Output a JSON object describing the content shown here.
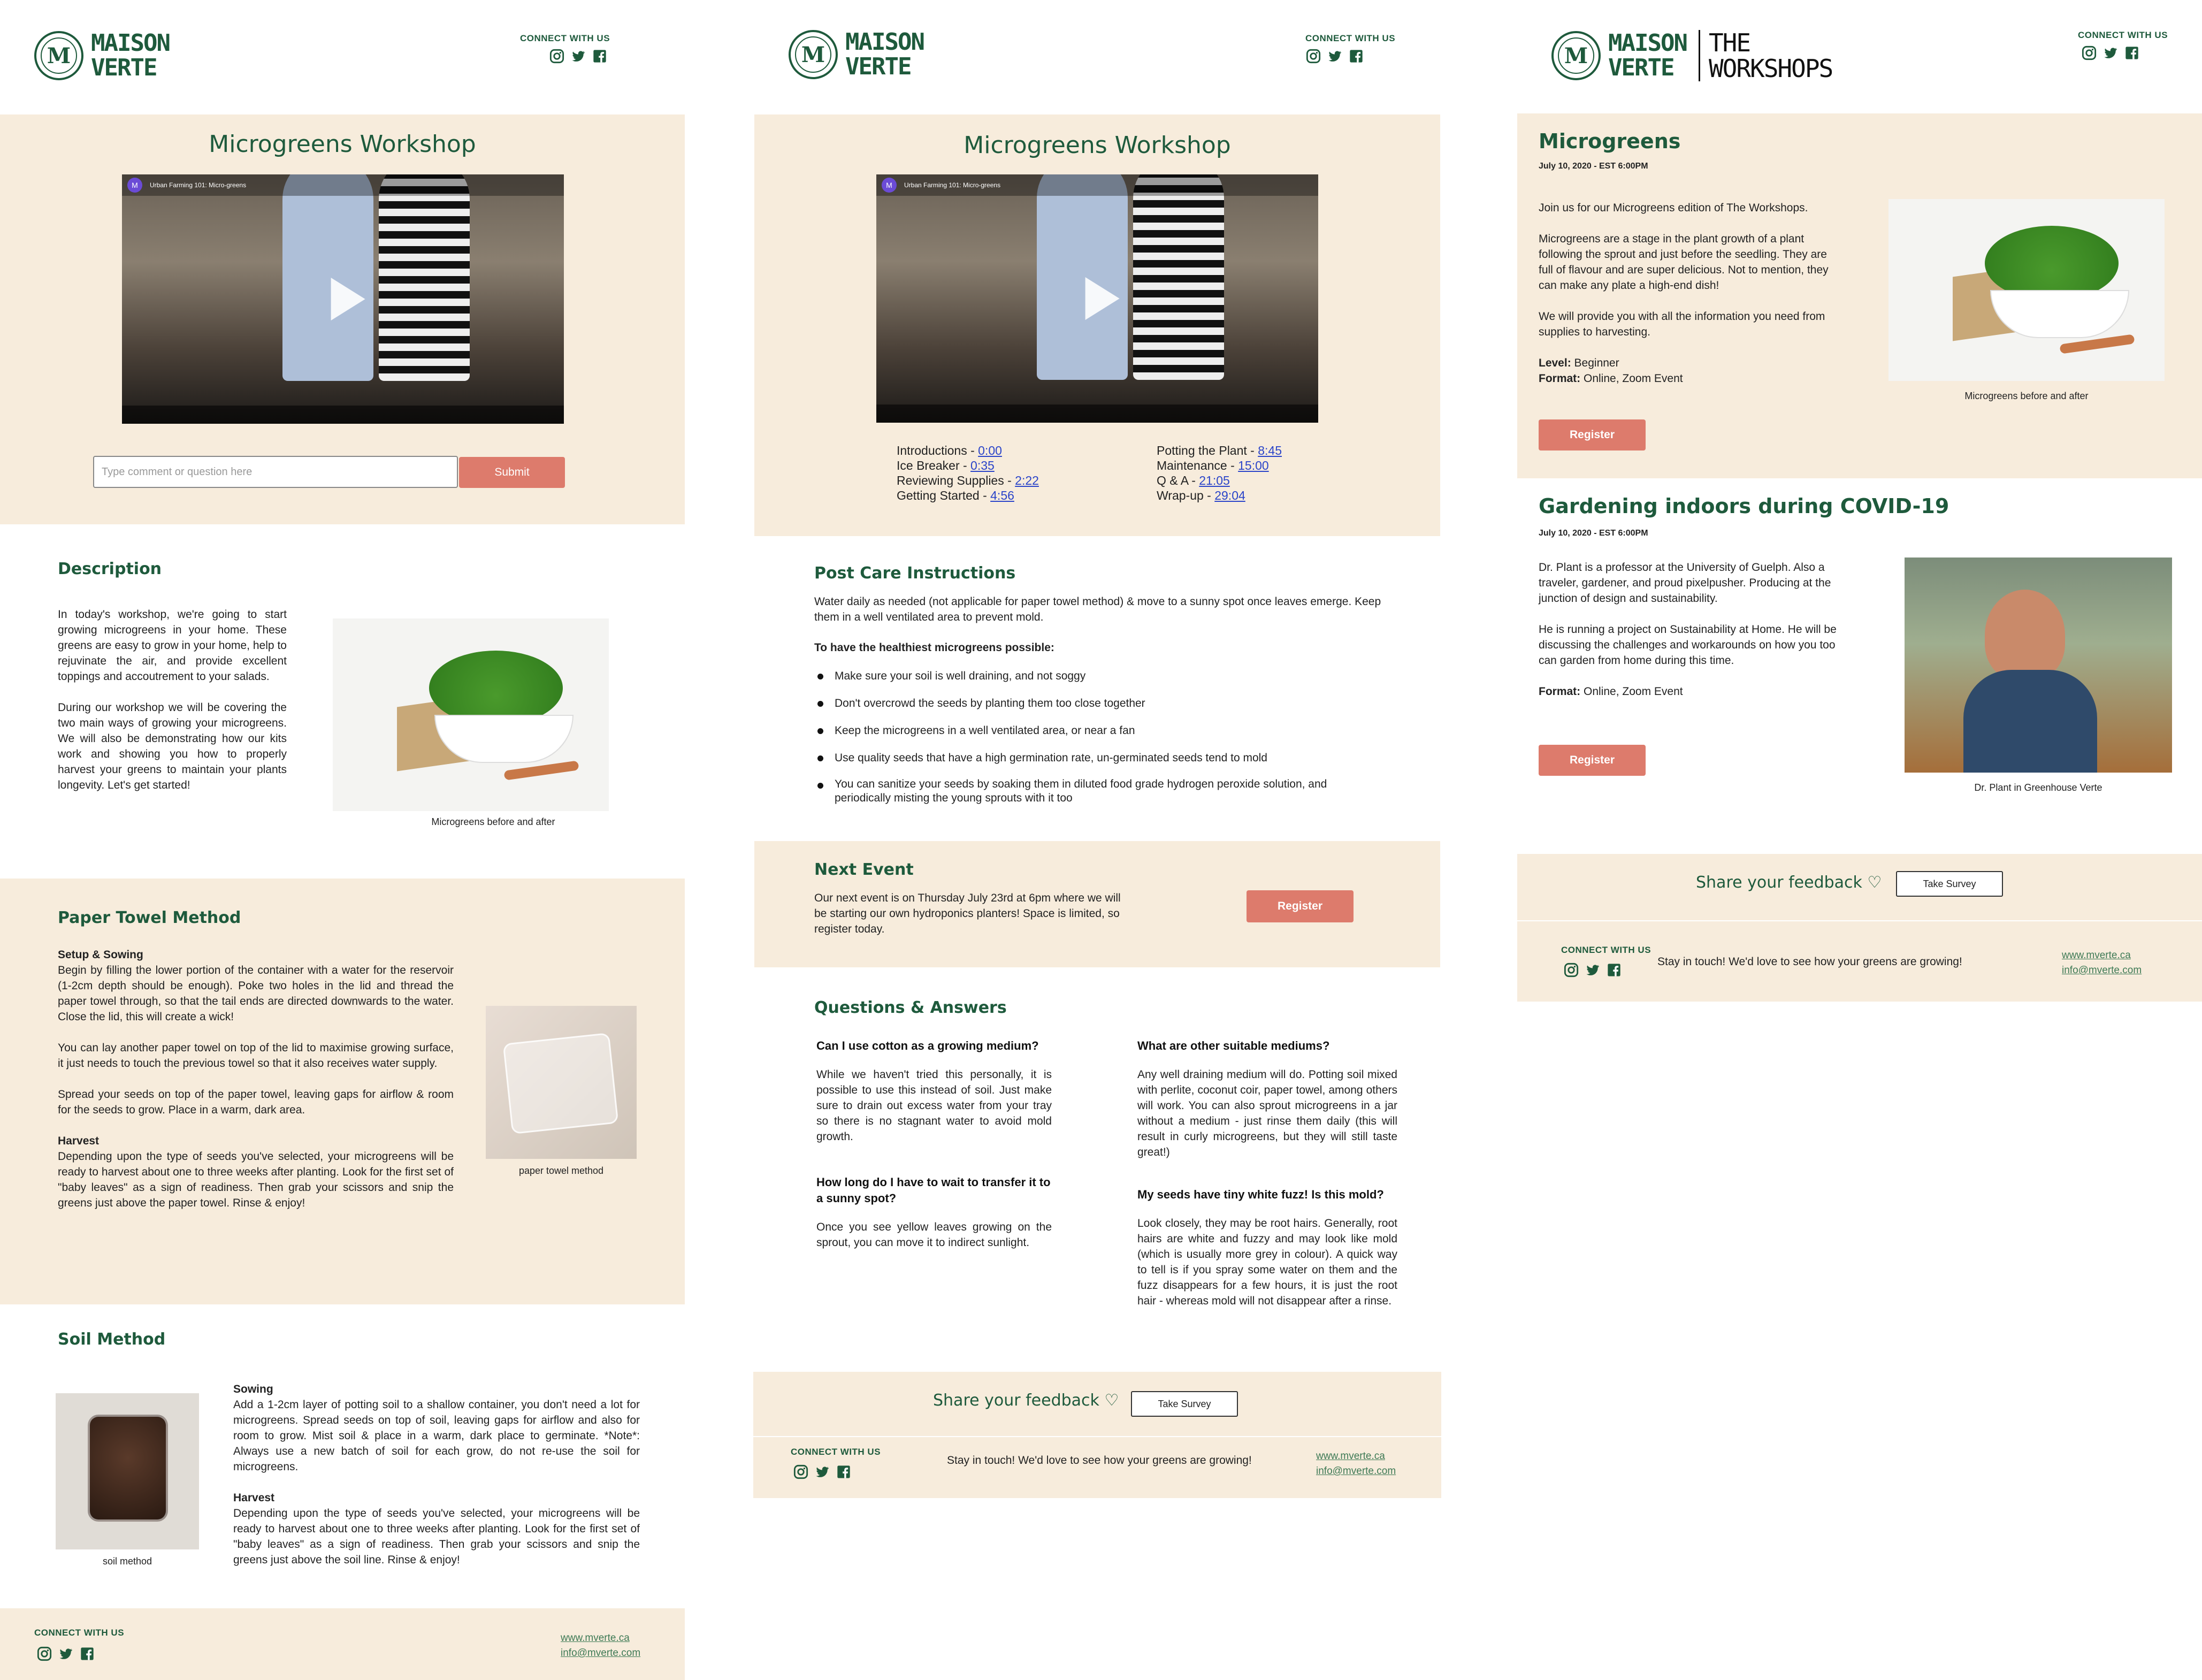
{
  "brand": {
    "logo_initial": "M",
    "logo_line1": "MAISON",
    "logo_line2": "VERTE",
    "workshops_line1": "THE",
    "workshops_line2": "WORKSHOPS",
    "connect_label": "CONNECT WITH US",
    "colors": {
      "green": "#1e5a3c",
      "beige": "#f7ecdc",
      "accent_red": "#dd7b6c"
    }
  },
  "panel1": {
    "title": "Microgreens Workshop",
    "video_title": "Urban Farming 101: Micro-greens",
    "comment_placeholder": "Type comment or question here",
    "submit_label": "Submit",
    "description": {
      "title": "Description",
      "p1": "In today's workshop, we're going to start growing microgreens in your home. These greens are easy to grow in your home, help to rejuvinate the air, and provide excellent toppings and accoutrement to your salads.",
      "p2": "During our workshop we will be covering the two main ways of growing your microgreens. We will also be demonstrating how our kits work and showing you how to properly harvest your greens to maintain your plants longevity. Let's get started!",
      "caption": "Microgreens before and after"
    },
    "paper_towel": {
      "title": "Paper Towel Method",
      "setup_head": "Setup & Sowing",
      "p1": "Begin by filling the lower portion of the container with a water for the reservoir (1-2cm depth should be enough). Poke two holes in the lid and thread the paper towel through, so that the tail ends are directed downwards to the water. Close the lid, this will create a wick!",
      "p2": "You can lay another paper towel on top of the lid to maximise growing surface, it just needs to touch the previous towel so that it also receives water supply.",
      "p3": "Spread your seeds on top of the paper towel, leaving gaps for airflow & room for the seeds to grow. Place in a warm, dark area.",
      "harvest_head": "Harvest",
      "p4": "Depending upon the type of seeds you've selected, your microgreens will be ready to harvest about one to three weeks after planting. Look for the first set of \"baby leaves\" as a sign of readiness. Then grab your scissors and snip the greens just above the paper towel. Rinse & enjoy!",
      "caption": "paper towel method"
    },
    "soil": {
      "title": "Soil Method",
      "sowing_head": "Sowing",
      "p1": "Add a 1-2cm layer of potting soil to a shallow container, you don't need a lot for microgreens. Spread seeds on top of soil, leaving gaps for airflow and also for room to grow. Mist soil & place in a warm, dark place to germinate.  *Note*: Always use a new batch of soil for each grow, do not re-use the soil for microgreens.",
      "harvest_head": "Harvest",
      "p2": "Depending upon the type of seeds you've selected, your microgreens will be ready to harvest about one to three weeks after planting. Look for the first set of \"baby leaves\" as a sign of readiness. Then grab your scissors and snip the greens just above the soil line. Rinse & enjoy!",
      "caption": "soil method"
    },
    "footer": {
      "website": "www.mverte.ca",
      "email": "info@mverte.com"
    }
  },
  "panel2": {
    "title": "Microgreens Workshop",
    "video_title": "Urban Farming 101: Micro-greens",
    "timestamps_left": [
      {
        "label": "Introductions - ",
        "time": "0:00"
      },
      {
        "label": "Ice Breaker - ",
        "time": "0:35"
      },
      {
        "label": "Reviewing Supplies - ",
        "time": "2:22"
      },
      {
        "label": "Getting Started - ",
        "time": "4:56"
      }
    ],
    "timestamps_right": [
      {
        "label": "Potting the Plant - ",
        "time": "8:45"
      },
      {
        "label": "Maintenance - ",
        "time": "15:00"
      },
      {
        "label": "Q & A -  ",
        "time": "21:05"
      },
      {
        "label": "Wrap-up - ",
        "time": "29:04"
      }
    ],
    "post_care": {
      "title": "Post Care Instructions",
      "intro": "Water daily as needed (not applicable for paper towel method) & move to a sunny spot once leaves emerge. Keep them in a well ventilated area to prevent mold.",
      "subhead": "To have the healthiest microgreens possible:",
      "bullets": [
        "Make sure your soil is well draining, and not soggy",
        "Don't overcrowd the seeds by planting them too close together",
        "Keep the microgreens in a well ventilated area, or near a fan",
        "Use quality seeds that have a high germination rate, un-germinated seeds tend to mold",
        "You can sanitize your seeds by soaking them in diluted food grade hydrogen peroxide solution, and periodically misting the young sprouts with it too"
      ]
    },
    "next_event": {
      "title": "Next Event",
      "text": "Our next event is on Thursday July 23rd at 6pm where we will be starting our own hydroponics planters! Space is limited, so register today.",
      "button": "Register"
    },
    "qa": {
      "title": "Questions & Answers",
      "q1": "Can I use cotton as a growing medium?",
      "a1": "While we haven't tried this personally, it is possible to use this instead of soil. Just make sure to drain out excess water from your tray so there is no stagnant water to avoid mold growth.",
      "q2": "How long do I have to wait to transfer it to a sunny spot?",
      "a2": "Once you see yellow leaves growing on the sprout, you can move it to indirect sunlight.",
      "q3": "What are other suitable mediums?",
      "a3": "Any well draining medium will do. Potting soil mixed with perlite, coconut coir, paper towel, among others will work. You can also sprout microgreens in a jar without a medium - just rinse them daily (this will result in curly microgreens, but they will still taste great!)",
      "q4": "My seeds have tiny white fuzz! Is this mold?",
      "a4": "Look closely, they may be root hairs. Generally, root hairs are white and fuzzy and may look like mold (which is usually more grey in colour). A quick way to tell is if you spray some water on them and the fuzz disappears for a few hours, it is just the root hair - whereas mold will not disappear after a rinse."
    },
    "feedback": {
      "text": "Share your feedback ♡",
      "button": "Take Survey"
    },
    "footer": {
      "tagline": "Stay in touch!  We'd love to see how your greens are growing!",
      "website": "www.mverte.ca",
      "email": "info@mverte.com"
    }
  },
  "panel3": {
    "event1": {
      "title": "Microgreens",
      "date": "July 10,  2020 - EST 6:00PM",
      "p1": "Join us for our Microgreens edition of The Workshops.",
      "p2": "Microgreens are a stage in the plant growth of a plant following the sprout and just before the seedling. They are full of flavour and are super delicious. Not to mention, they can make any plate a high-end dish!",
      "p3": "We will provide you with all the information you need from supplies to harvesting.",
      "level_label": "Level:",
      "level_value": " Beginner",
      "format_label": "Format:",
      "format_value": " Online, Zoom Event",
      "button": "Register",
      "caption": "Microgreens before and after"
    },
    "event2": {
      "title": "Gardening indoors during COVID-19",
      "date": "July 10,  2020 - EST 6:00PM",
      "p1": "Dr. Plant is a professor at the University of Guelph. Also a traveler, gardener, and proud pixelpusher. Producing at the junction of design and sustainability.",
      "p2": "He is running a project on Sustainability at Home. He will be discussing the challenges and workarounds on how you too can garden from home during this time.",
      "format_label": "Format:",
      "format_value": " Online, Zoom Event",
      "button": "Register",
      "caption": "Dr. Plant in Greenhouse Verte"
    },
    "feedback": {
      "text": "Share your feedback ♡",
      "button": "Take Survey"
    },
    "footer": {
      "tagline": "Stay in touch!  We'd love to see how your greens are growing!",
      "website": "www.mverte.ca",
      "email": "info@mverte.com"
    }
  },
  "icons": [
    "instagram-icon",
    "twitter-icon",
    "facebook-icon",
    "play-icon"
  ]
}
